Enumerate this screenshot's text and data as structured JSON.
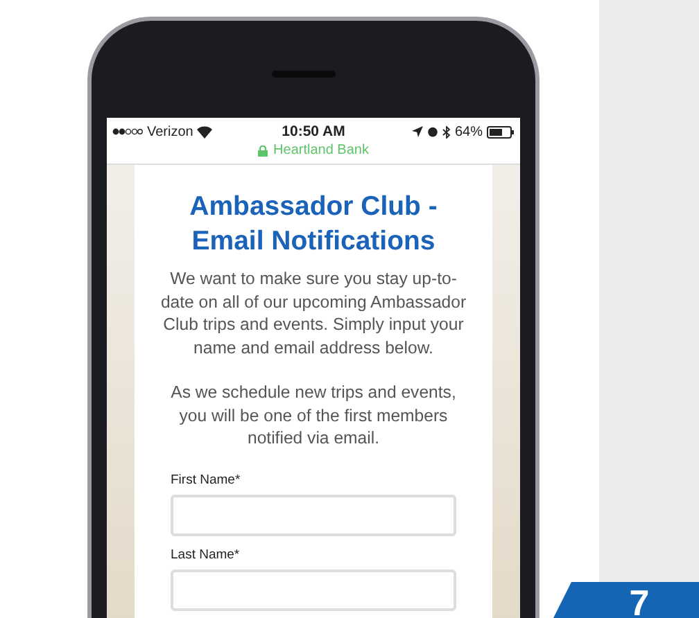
{
  "status_bar": {
    "carrier": "Verizon",
    "time": "10:50 AM",
    "battery": "64%"
  },
  "address_bar": {
    "site": "Heartland Bank"
  },
  "page": {
    "title": "Ambassador Club - Email Notifications",
    "paragraphs": [
      "We want to make sure you stay up-to-date on all of our upcoming Ambassador Club trips and events. Simply input your name and email address below.",
      "As we schedule new  trips and events, you will be one of the first members notified via email."
    ],
    "fields": [
      {
        "label": "First Name*"
      },
      {
        "label": "Last Name*"
      }
    ]
  },
  "badge": "7"
}
